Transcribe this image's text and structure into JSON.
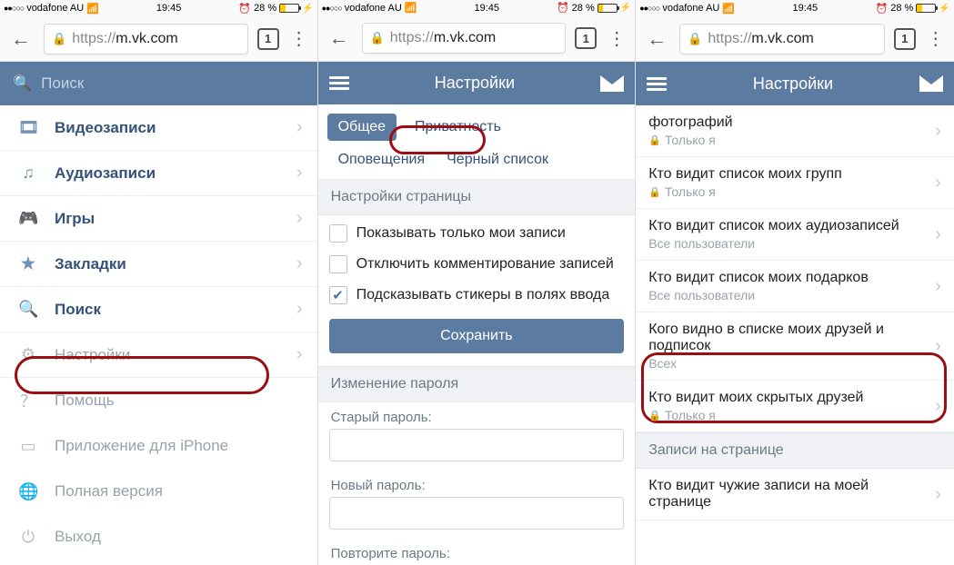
{
  "status": {
    "carrier": "vodafone AU",
    "time": "19:45",
    "battery": "28 %",
    "signal_dots": "●●○○○"
  },
  "browser": {
    "url_host": "m.vk.com",
    "url_scheme": "https://",
    "tab_count": "1"
  },
  "pane1": {
    "search_placeholder": "Поиск",
    "items": [
      {
        "label": "Видеозаписи"
      },
      {
        "label": "Аудиозаписи"
      },
      {
        "label": "Игры"
      },
      {
        "label": "Закладки"
      },
      {
        "label": "Поиск"
      },
      {
        "label": "Настройки"
      },
      {
        "label": "Помощь"
      },
      {
        "label": "Приложение для iPhone"
      },
      {
        "label": "Полная версия"
      },
      {
        "label": "Выход"
      }
    ]
  },
  "pane2": {
    "header": "Настройки",
    "tabs": {
      "general": "Общее",
      "privacy": "Приватность",
      "notifications": "Оповещения",
      "blacklist": "Чёрный список"
    },
    "section_page": "Настройки страницы",
    "checks": {
      "only_my_posts": "Показывать только мои записи",
      "disable_comments": "Отключить комментирование записей",
      "sticker_suggest": "Подсказывать стикеры в полях ввода"
    },
    "save": "Сохранить",
    "section_pwd": "Изменение пароля",
    "old_pwd": "Старый пароль:",
    "new_pwd": "Новый пароль:",
    "repeat_pwd": "Повторите пароль:"
  },
  "pane3": {
    "header": "Настройки",
    "rows": [
      {
        "title": "фотографий",
        "sub": "Только я",
        "locked": true
      },
      {
        "title": "Кто видит список моих групп",
        "sub": "Только я",
        "locked": true
      },
      {
        "title": "Кто видит список моих аудиозаписей",
        "sub": "Все пользователи",
        "locked": false
      },
      {
        "title": "Кто видит список моих подарков",
        "sub": "Все пользователи",
        "locked": false
      },
      {
        "title": "Кого видно в списке моих друзей и подписок",
        "sub": "Всех",
        "locked": false
      },
      {
        "title": "Кто видит моих скрытых друзей",
        "sub": "Только я",
        "locked": true
      }
    ],
    "section_wall": "Записи на странице",
    "wall_row": {
      "title": "Кто видит чужие записи на моей странице"
    }
  }
}
